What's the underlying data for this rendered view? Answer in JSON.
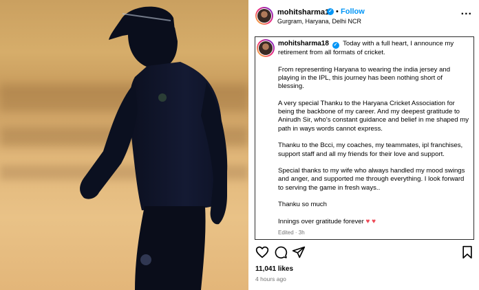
{
  "header": {
    "username": "mohitsharma18",
    "follow_label": "Follow",
    "separator": "•",
    "location": "Gurgram, Haryana, Delhi NCR",
    "more_label": "..."
  },
  "caption": {
    "username": "mohitsharma18",
    "paragraphs": [
      "Today with a full heart, I announce my retirement from all formats of cricket.",
      "From representing Haryana to wearing the india jersey and playing in the IPL, this journey has been nothing short of blessing.",
      "A very special Thanku to the Haryana Cricket Association for being the backbone of my career. And my deepest gratitude to Anirudh Sir, who's constant guidance and belief in me shaped my path in ways words cannot express.",
      "Thanku to the Bcci, my coaches, my teammates, ipl franchises, support staff and all my friends for their love and support.",
      "Special thanks to my wife who always handled my mood swings and anger, and supported me through everything. I look forward to serving the game in fresh ways..",
      "Thanku so much",
      "Innings over gratitude forever"
    ],
    "hearts": "♥ ♥",
    "edited": "Edited · 3h"
  },
  "icons": {
    "verified": "✓",
    "like": "heart-icon",
    "comment": "comment-icon",
    "share": "share-icon",
    "save": "bookmark-icon"
  },
  "stats": {
    "likes": "11,041 likes",
    "time": "4 hours ago"
  },
  "colors": {
    "accent": "#0095f6",
    "heart": "#ed4956",
    "muted": "#737373"
  }
}
